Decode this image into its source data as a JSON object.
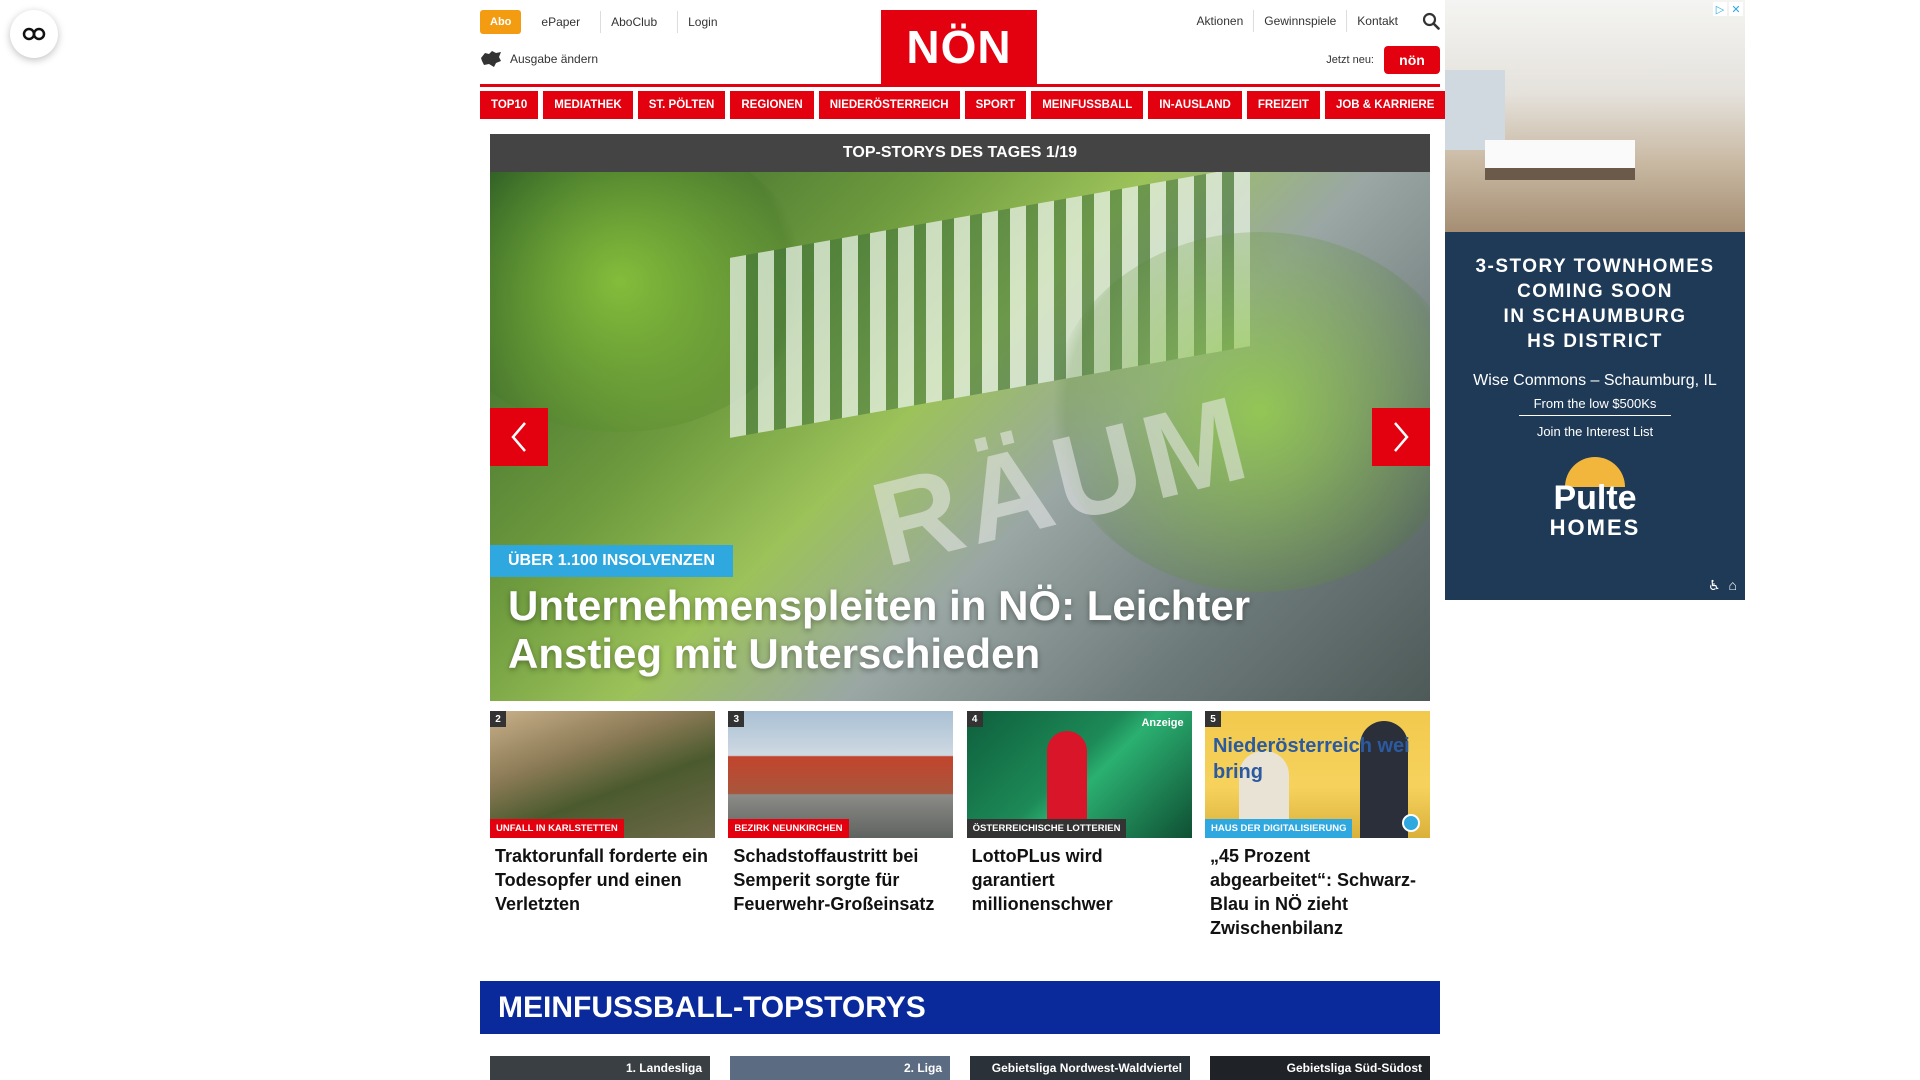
{
  "header": {
    "abo_label": "Abo",
    "top_links": [
      "ePaper",
      "AboClub",
      "Login"
    ],
    "edition_label": "Ausgabe ändern",
    "logo_text": "NÖN",
    "right_links": [
      "Aktionen",
      "Gewinnspiele",
      "Kontakt"
    ],
    "jetzt_label": "Jetzt neu:",
    "jetzt_badge": "nön"
  },
  "nav": {
    "items": [
      "TOP10",
      "MEDIATHEK",
      "ST. PÖLTEN",
      "REGIONEN",
      "NIEDERÖSTERREICH",
      "SPORT",
      "MEINFUSSBALL",
      "IN-AUSLAND",
      "FREIZEIT",
      "JOB & KARRIERE"
    ]
  },
  "hero": {
    "header": "TOP-STORYS DES TAGES 1/19",
    "image_text": "RÄUM",
    "tag": "ÜBER 1.100 INSOLVENZEN",
    "title": "Unternehmenspleiten in NÖ: Leichter Anstieg mit Unterschieden"
  },
  "cards": [
    {
      "num": "2",
      "category": "UNFALL IN KARLSTETTEN",
      "title": "Traktorunfall forderte ein Todesopfer und einen Verletzten",
      "ad": ""
    },
    {
      "num": "3",
      "category": "BEZIRK NEUNKIRCHEN",
      "title": "Schadstoffaustritt bei Semperit sorgte für Feuerwehr-Großeinsatz",
      "ad": ""
    },
    {
      "num": "4",
      "category": "ÖSTERREICHISCHE LOTTERIEN",
      "title": "LottoPLus wird garantiert millionenschwer",
      "ad": "Anzeige"
    },
    {
      "num": "5",
      "category": "HAUS DER DIGITALISIERUNG",
      "title": "„45 Prozent abgearbeitet“: Schwarz-Blau in NÖ zieht Zwischenbilanz",
      "ad": "",
      "image_text": "Niederösterreich wei bring"
    }
  ],
  "section": {
    "title": "MEINFUSSBALL-TOPSTORYS",
    "teasers": [
      "1. Landesliga",
      "2. Liga",
      "Gebietsliga Nordwest-Waldviertel",
      "Gebietsliga Süd-Südost"
    ]
  },
  "ad": {
    "headline": [
      "3-STORY TOWNHOMES",
      "COMING SOON",
      "IN SCHAUMBURG",
      "HS DISTRICT"
    ],
    "location": "Wise Commons – Schaumburg, IL",
    "price": "From the low $500Ks",
    "cta": "Join the Interest List",
    "brand_top": "Pulte",
    "brand_bottom": "HOMES"
  },
  "colors": {
    "brand_red": "#e3000f",
    "abo_orange": "#f39c12",
    "tag_blue": "#2fa8e0",
    "section_blue": "#0a2a9c",
    "ad_navy": "#1f3a56"
  },
  "icons": [
    "accessibility-icon",
    "map-icon",
    "search-icon",
    "chevron-left-icon",
    "chevron-right-icon",
    "play-icon",
    "ad-info-icon",
    "close-icon",
    "wheelchair-icon",
    "equal-housing-icon"
  ]
}
